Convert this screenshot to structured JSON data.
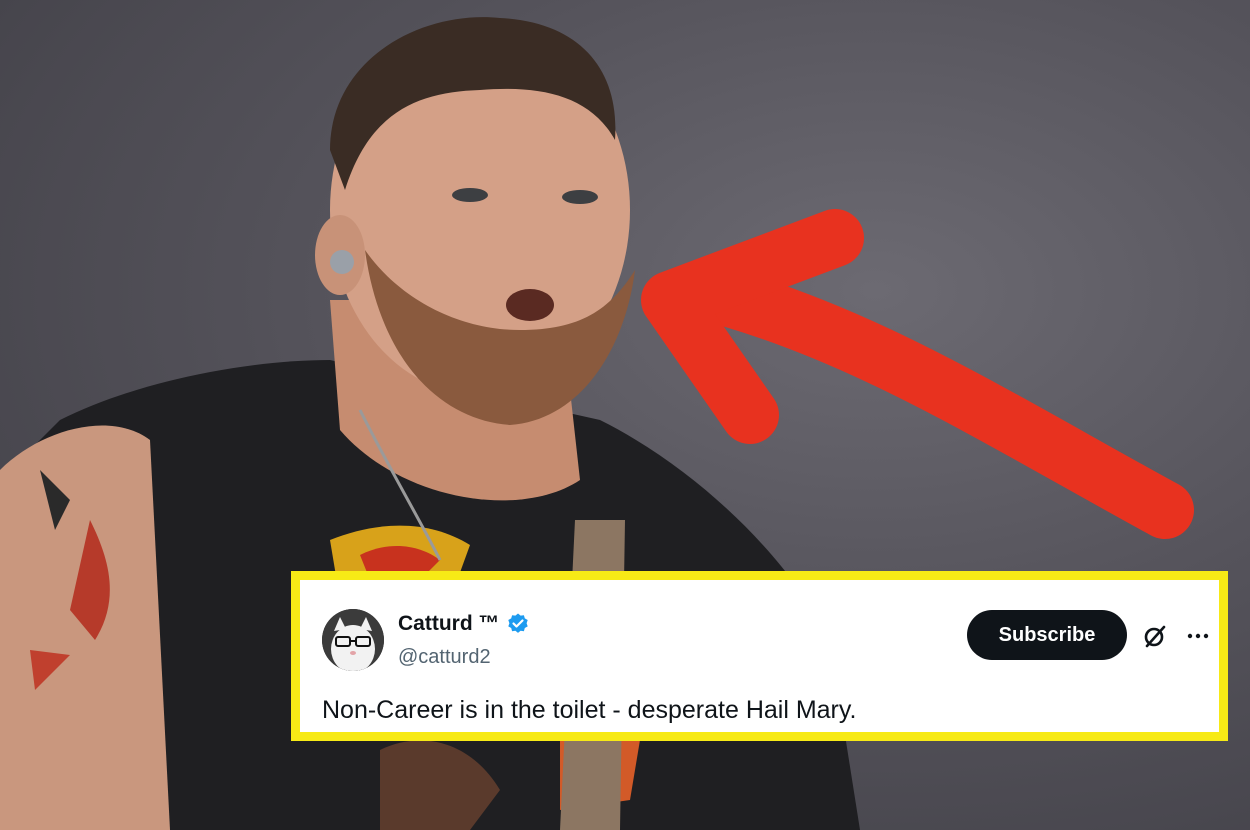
{
  "tweet": {
    "display_name": "Catturd ™",
    "handle": "@catturd2",
    "subscribe_label": "Subscribe",
    "text": "Non-Career is in the toilet - desperate Hail Mary.",
    "verified": true,
    "icons": {
      "verified": "verified-badge-icon",
      "grok": "grok-icon",
      "more": "more-icon"
    }
  },
  "colors": {
    "highlight_border": "#f7ea16",
    "arrow": "#e8321f",
    "verified": "#1d9bf0",
    "subscribe_bg": "#0f1419"
  }
}
